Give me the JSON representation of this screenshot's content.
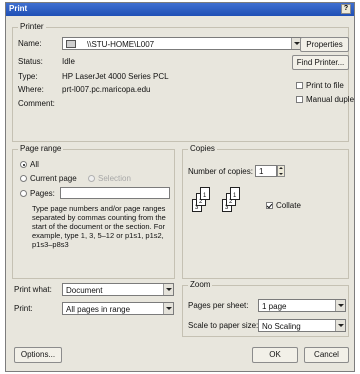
{
  "dialog": {
    "title": "Print",
    "help": "?"
  },
  "printer": {
    "group_label": "Printer",
    "name_label": "Name:",
    "name_value": "\\\\STU-HOME\\L007",
    "status_label": "Status:",
    "status_value": "Idle",
    "type_label": "Type:",
    "type_value": "HP LaserJet 4000 Series PCL",
    "where_label": "Where:",
    "where_value": "prt-l007.pc.maricopa.edu",
    "comment_label": "Comment:",
    "comment_value": "",
    "properties_button": "Properties",
    "find_printer_button": "Find Printer...",
    "print_to_file_label": "Print to file",
    "print_to_file_checked": false,
    "manual_duplex_label": "Manual duplex",
    "manual_duplex_checked": false
  },
  "page_range": {
    "group_label": "Page range",
    "all_label": "All",
    "current_page_label": "Current page",
    "selection_label": "Selection",
    "pages_label": "Pages:",
    "pages_value": "",
    "selected": "all",
    "help_text": "Type page numbers and/or page ranges separated by commas counting from the start of the document or the section. For example, type 1, 3, 5–12 or p1s1, p1s2, p1s3–p8s3"
  },
  "copies": {
    "group_label": "Copies",
    "number_label": "Number of copies:",
    "number_value": "1",
    "collate_label": "Collate",
    "collate_checked": true,
    "collate_pages": [
      "1",
      "2",
      "3"
    ]
  },
  "print_what": {
    "label": "Print what:",
    "value": "Document",
    "print_label": "Print:",
    "print_value": "All pages in range"
  },
  "zoom": {
    "group_label": "Zoom",
    "pages_per_sheet_label": "Pages per sheet:",
    "pages_per_sheet_value": "1 page",
    "scale_label": "Scale to paper size:",
    "scale_value": "No Scaling"
  },
  "footer": {
    "options_button": "Options...",
    "ok_button": "OK",
    "cancel_button": "Cancel"
  }
}
